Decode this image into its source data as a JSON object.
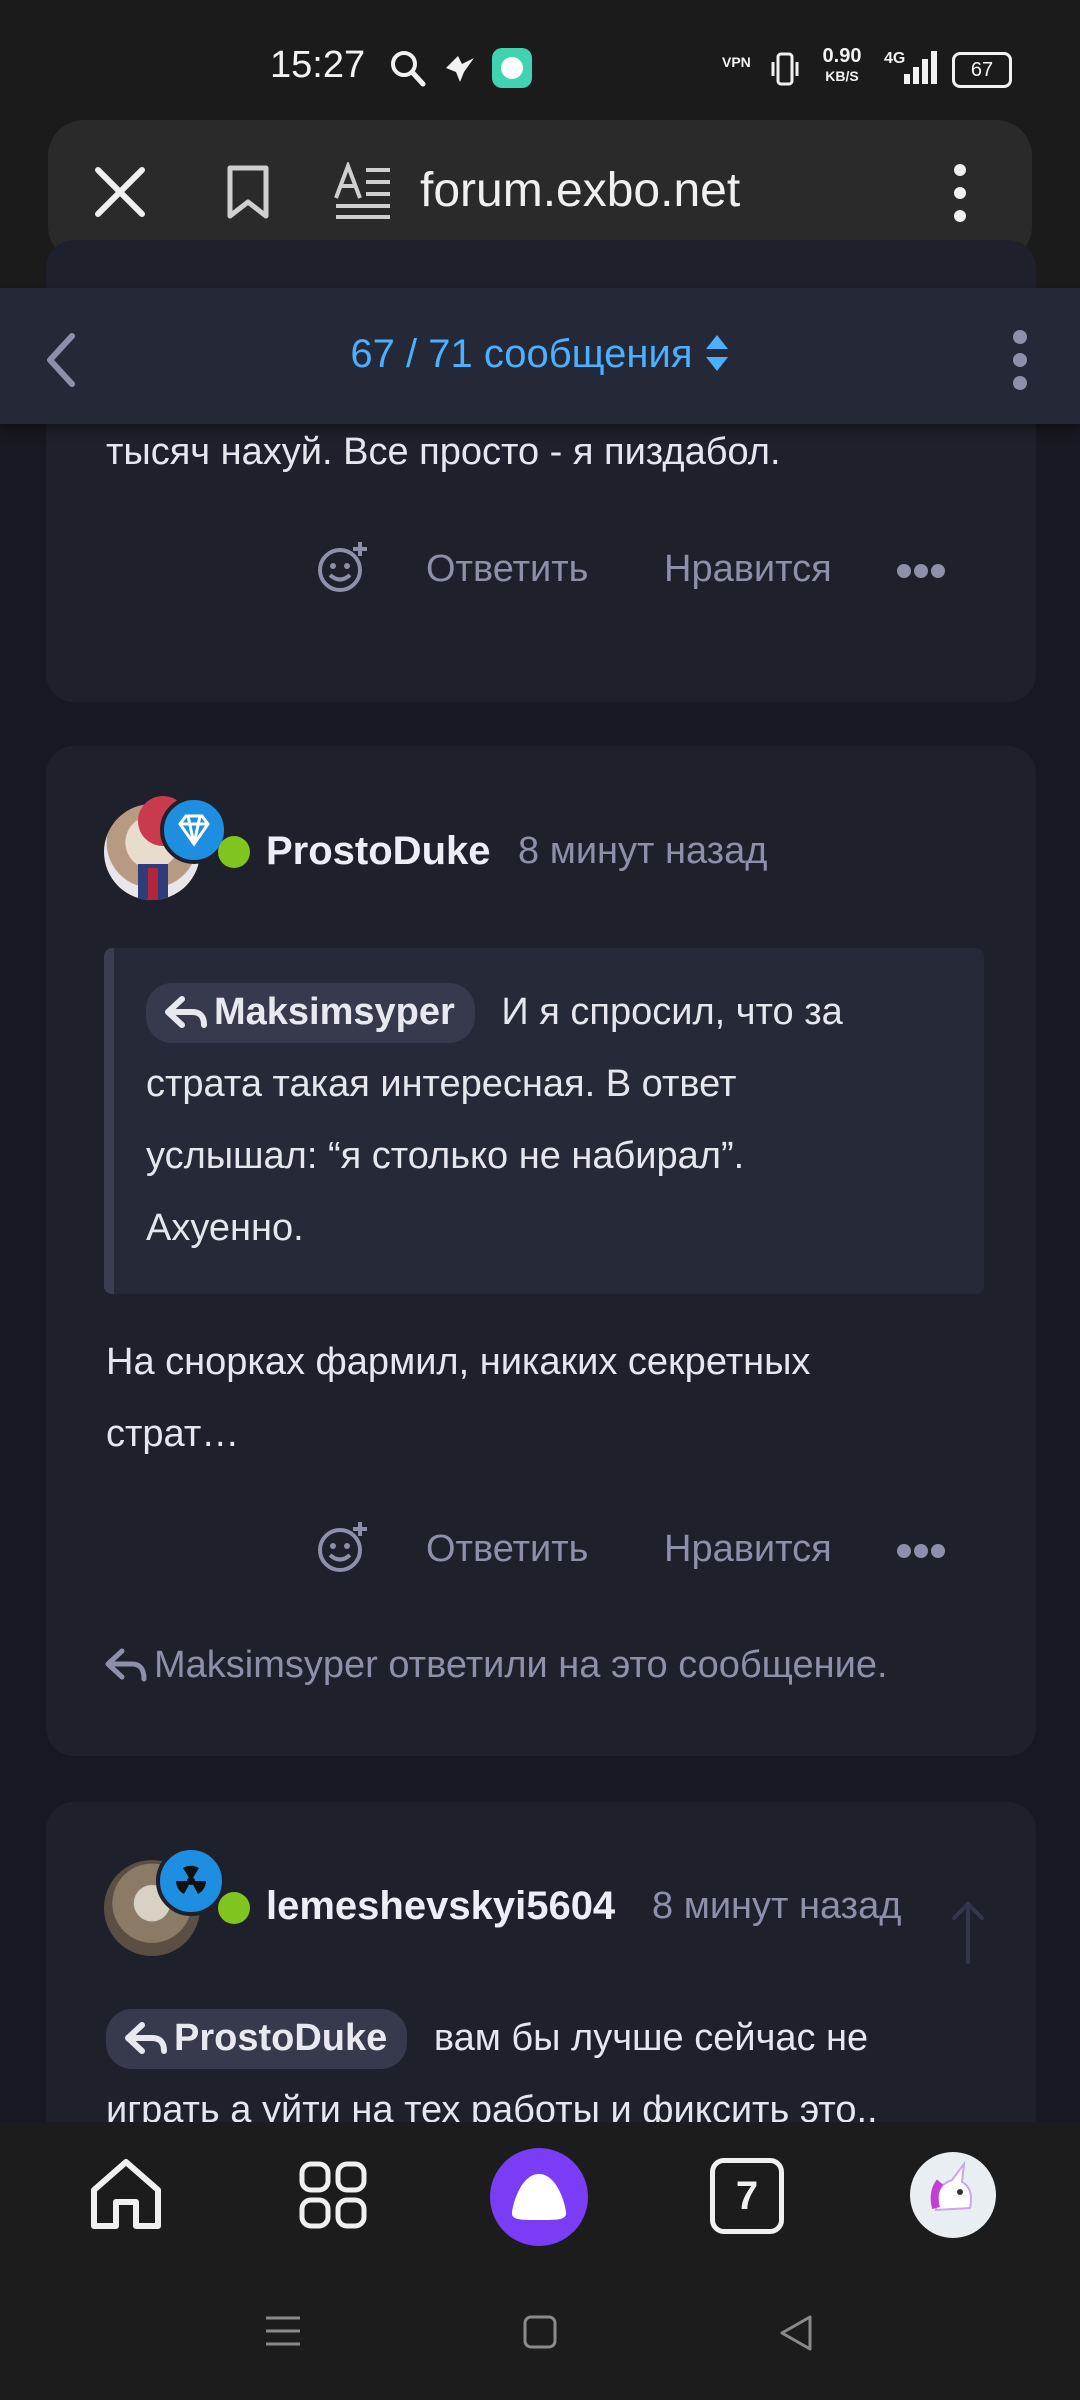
{
  "status_bar": {
    "time": "15:27",
    "net_speed_value": "0.90",
    "net_speed_unit": "KB/S",
    "vpn": "VPN",
    "network": "4G",
    "battery": "67"
  },
  "browser": {
    "url": "forum.exbo.net"
  },
  "thread_nav": {
    "count": "67 / 71 сообщения"
  },
  "posts": [
    {
      "text_tail": "тысяч нахуй. Все просто - я пиздабол.",
      "actions": {
        "reply": "Ответить",
        "like": "Нравится"
      }
    },
    {
      "username": "ProstoDuke",
      "time": "8 минут назад",
      "quote": {
        "mention": "Maksimsyper",
        "text_line1": "И я спросил, что за",
        "text_line2": "страта такая интересная. В ответ",
        "text_line3": "услышал: “я столько не набирал”.",
        "text_line4": "Ахуенно."
      },
      "text_line1": "На снорках фармил, никаких секретных",
      "text_line2": "страт…",
      "actions": {
        "reply": "Ответить",
        "like": "Нравится"
      },
      "replied_by": "Maksimsyper ответили на это сообщение."
    },
    {
      "username": "lemeshevskyi5604",
      "time": "8 минут назад",
      "mention": "ProstoDuke",
      "text_line1": "вам бы лучше сейчас не",
      "text_line2": "играть а уйти на тех работы и фиксить это.."
    }
  ],
  "bottom_nav": {
    "tabs_count": "7"
  },
  "colors": {
    "accent": "#4bb0ff",
    "online": "#7fc41f",
    "alice": "#7a3cf5"
  }
}
